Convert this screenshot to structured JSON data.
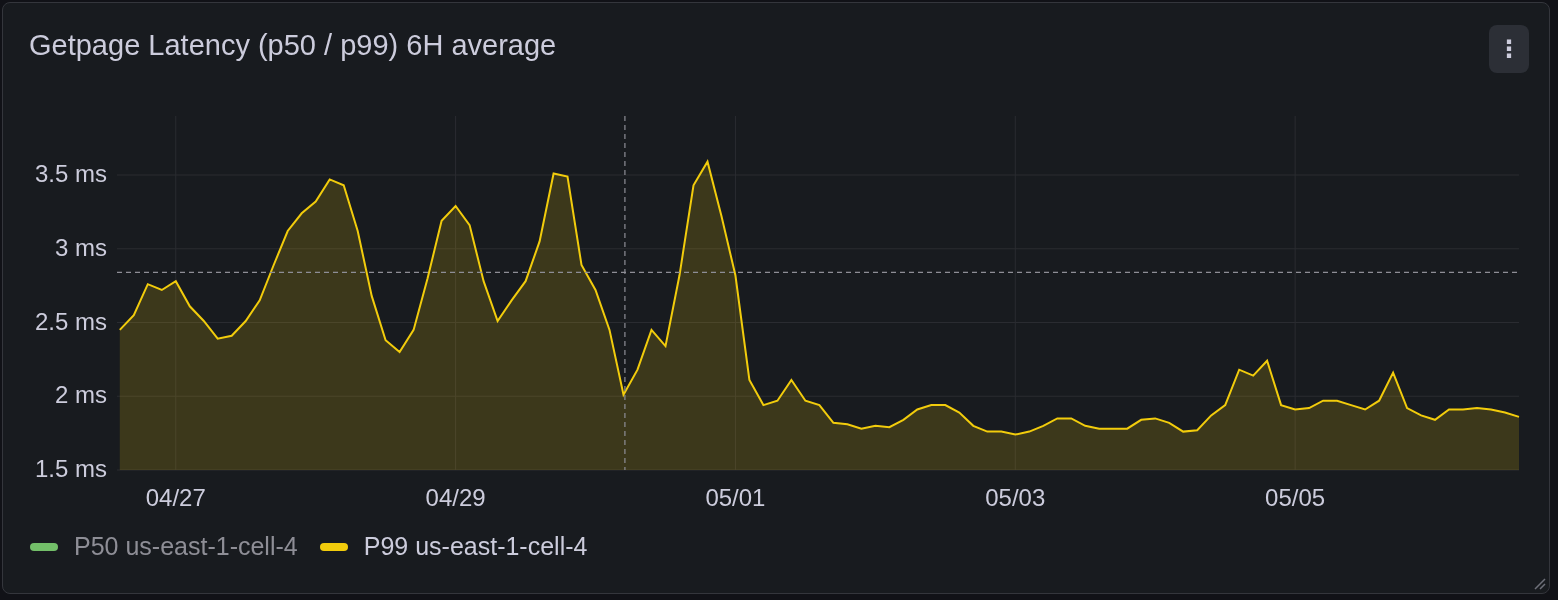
{
  "panel": {
    "title": "Getpage Latency (p50 / p99) 6H average"
  },
  "menu_button": {
    "label": "⋮"
  },
  "chart_data": {
    "type": "area",
    "ylim": [
      1.5,
      3.9
    ],
    "yticks": [
      {
        "value": 1.5,
        "label": "1.5 ms"
      },
      {
        "value": 2,
        "label": "2 ms"
      },
      {
        "value": 2.5,
        "label": "2.5 ms"
      },
      {
        "value": 3,
        "label": "3 ms"
      },
      {
        "value": 3.5,
        "label": "3.5 ms"
      }
    ],
    "categories": [
      null,
      null,
      null,
      null,
      "04/27",
      null,
      null,
      null,
      null,
      null,
      null,
      null,
      null,
      null,
      null,
      null,
      null,
      null,
      null,
      null,
      null,
      null,
      null,
      null,
      "04/29",
      null,
      null,
      null,
      null,
      null,
      null,
      null,
      null,
      null,
      null,
      null,
      null,
      null,
      null,
      null,
      null,
      null,
      null,
      null,
      "05/01",
      null,
      null,
      null,
      null,
      null,
      null,
      null,
      null,
      null,
      null,
      null,
      null,
      null,
      null,
      null,
      null,
      null,
      null,
      null,
      "05/03",
      null,
      null,
      null,
      null,
      null,
      null,
      null,
      null,
      null,
      null,
      null,
      null,
      null,
      null,
      null,
      null,
      null,
      null,
      null,
      "05/05",
      null,
      null,
      null,
      null,
      null,
      null,
      null,
      null,
      null,
      null,
      null,
      null,
      null,
      null,
      null,
      null
    ],
    "series": [
      {
        "name": "P99 us-east-1-cell-4",
        "color": "#f2cc0c",
        "values": [
          2.45,
          2.55,
          2.76,
          2.72,
          2.78,
          2.61,
          2.51,
          2.39,
          2.41,
          2.51,
          2.65,
          2.89,
          3.12,
          3.24,
          3.32,
          3.47,
          3.43,
          3.12,
          2.68,
          2.38,
          2.3,
          2.45,
          2.8,
          3.19,
          3.29,
          3.16,
          2.78,
          2.51,
          2.65,
          2.78,
          3.05,
          3.51,
          3.49,
          2.89,
          2.72,
          2.45,
          2.01,
          2.18,
          2.45,
          2.34,
          2.82,
          3.43,
          3.59,
          3.22,
          2.82,
          2.11,
          1.94,
          1.97,
          2.11,
          1.97,
          1.94,
          1.82,
          1.81,
          1.78,
          1.8,
          1.79,
          1.84,
          1.91,
          1.94,
          1.94,
          1.89,
          1.8,
          1.76,
          1.76,
          1.74,
          1.76,
          1.8,
          1.85,
          1.85,
          1.8,
          1.78,
          1.78,
          1.78,
          1.84,
          1.85,
          1.82,
          1.76,
          1.77,
          1.87,
          1.94,
          2.18,
          2.14,
          2.24,
          1.94,
          1.91,
          1.92,
          1.97,
          1.97,
          1.94,
          1.91,
          1.97,
          2.16,
          1.92,
          1.87,
          1.84,
          1.91,
          1.91,
          1.92,
          1.91,
          1.89,
          1.86
        ]
      }
    ],
    "grid": true,
    "ref_lines": [
      {
        "axis": "y",
        "value": 2.84
      }
    ]
  },
  "hidden_series": [
    {
      "name": "P50 us-east-1-cell-4",
      "color": "#73bf69"
    }
  ]
}
